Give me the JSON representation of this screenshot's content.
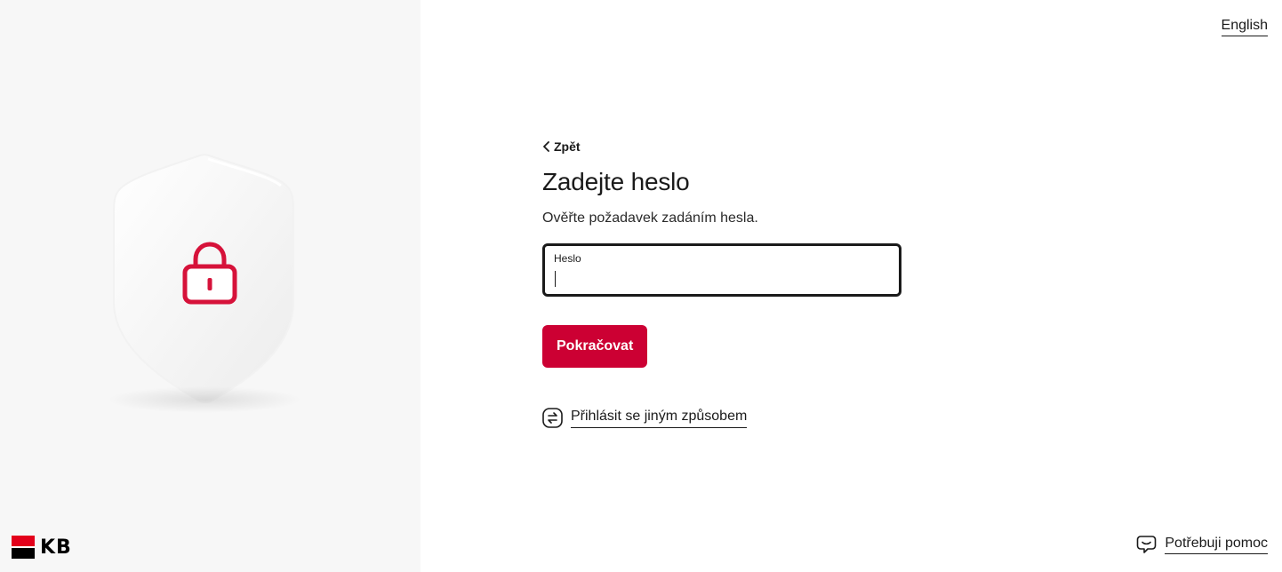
{
  "header": {
    "language_link": "English"
  },
  "brand": {
    "logo_text": "KB",
    "red": "#e3001b"
  },
  "form": {
    "back_label": "Zpět",
    "title": "Zadejte heslo",
    "subtitle": "Ověřte požadavek zadáním hesla.",
    "password_label": "Heslo",
    "password_value": "",
    "continue_button": "Pokračovat",
    "alt_login_label": "Přihlásit se jiným způsobem"
  },
  "footer": {
    "help_label": "Potřebuji pomoc"
  },
  "illustration": {
    "icon": "shield-lock-icon",
    "accent": "#d6123a"
  },
  "colors": {
    "primary": "#cc0033",
    "left_panel_bg": "#f7f7f7"
  }
}
